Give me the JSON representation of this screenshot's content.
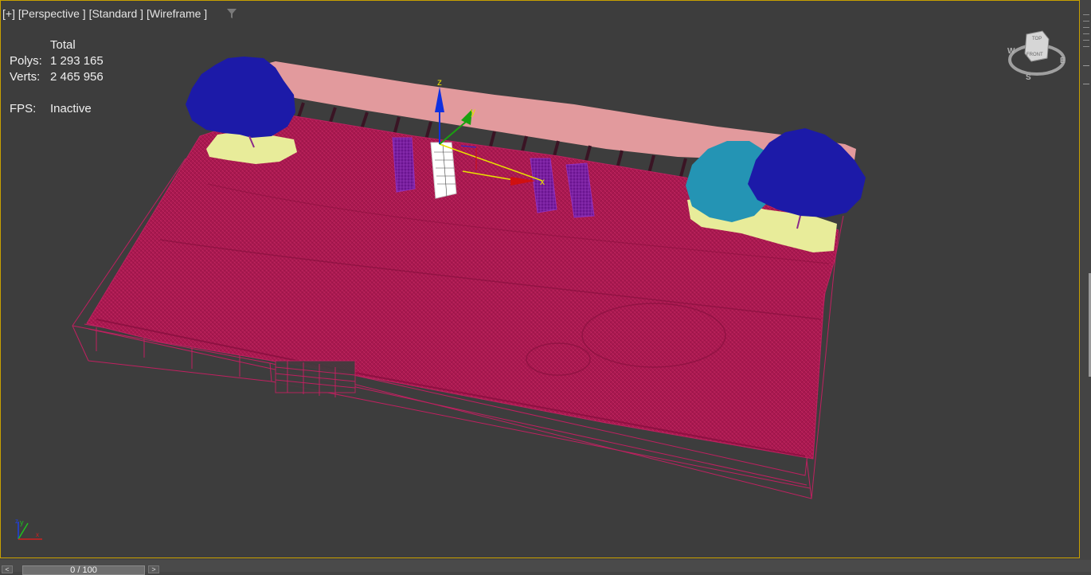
{
  "viewport": {
    "labels": [
      "[+]",
      "[Perspective ]",
      "[Standard ]",
      "[Wireframe ]"
    ]
  },
  "stats": {
    "header": "Total",
    "polys_label": "Polys:",
    "polys_value": "1 293 165",
    "verts_label": "Verts:",
    "verts_value": "2 465 956",
    "fps_label": "FPS:",
    "fps_value": "Inactive"
  },
  "gizmo": {
    "x": "x",
    "y": "y",
    "z": "z"
  },
  "viewcube": {
    "top": "TOP",
    "front": "FRONT",
    "west": "W",
    "south": "S",
    "east": "E"
  },
  "timeline": {
    "position": "0 / 100",
    "prev": "<",
    "next": ">"
  },
  "colors": {
    "ground": "#a8184f",
    "hedge": "#e29a9d",
    "tree_blue": "#1c1aa8",
    "tree_teal": "#2494b4",
    "flowerbed": "#e8ec9a",
    "bench_purple": "#7a1a98",
    "gizmo_x": "#d01010",
    "gizmo_y": "#e8e000",
    "gizmo_z": "#1030e0",
    "viewport_border": "#c8a000"
  }
}
